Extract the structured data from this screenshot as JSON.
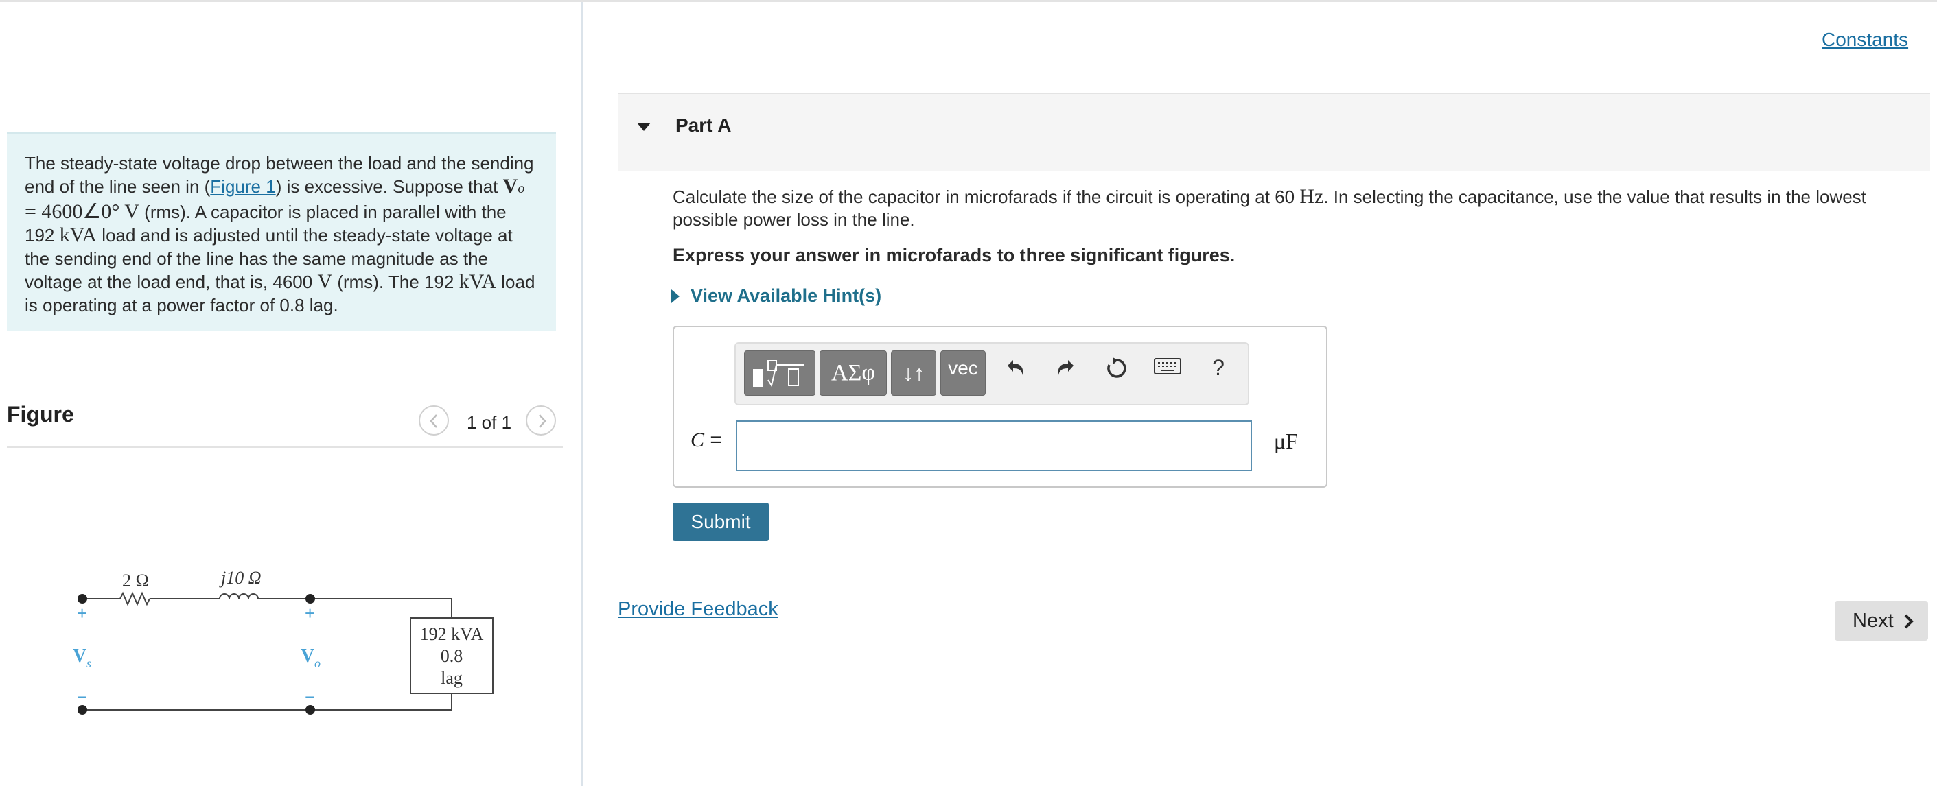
{
  "problem": {
    "seg1": "The steady-state voltage drop between the load and the sending end of the line seen in (",
    "figure_link": "Figure 1",
    "seg2": ") is excessive. Suppose that ",
    "vo_symbol": "V",
    "vo_sub": "o",
    "vo_value": " = 4600∠0° V",
    "seg3": " (rms). A capacitor is placed in parallel with the 192 ",
    "kva1": "kVA",
    "seg4": " load and is adjusted until the steady-state voltage at the sending end of the line has the same magnitude as the voltage at the load end, that is, 4600 ",
    "volt": "V",
    "seg5": " (rms). The 192 ",
    "kva2": "kVA",
    "seg6": " load is operating at a power factor of 0.8 lag."
  },
  "figure": {
    "title": "Figure",
    "counter": "1 of 1",
    "circuit": {
      "r_label": "2 Ω",
      "x_label": "j10 Ω",
      "vs_label": "V",
      "vs_sub": "s",
      "vo_label": "V",
      "vo_sub": "o",
      "plus": "+",
      "minus": "−",
      "load_line1": "192 kVA",
      "load_line2": "0.8",
      "load_line3": "lag"
    }
  },
  "constants_link": "Constants",
  "part": {
    "title": "Part A",
    "q1": "Calculate the size of the capacitor in microfarads if the circuit is operating at 60 ",
    "hz": "Hz",
    "q2": ". In selecting the capacitance, use the value that results in the lowest possible power loss in the line.",
    "instruction": "Express your answer in microfarads to three significant figures.",
    "hint_label": "View Available Hint(s)"
  },
  "answer": {
    "toolbar": {
      "greek": "ΑΣφ",
      "arrows": "↓↑",
      "vec": "vec",
      "help": "?"
    },
    "var_symbol": "C",
    "var_equals": " =",
    "input_value": "",
    "unit": "μF"
  },
  "submit_label": "Submit",
  "feedback_link": "Provide Feedback",
  "next_label": "Next",
  "colors": {
    "accent": "#2f7395",
    "link": "#1a6fa1",
    "hint": "#1f6f8b",
    "problem_bg": "#e6f4f6",
    "toolbar_btn": "#7d7d7d",
    "circuit_blue": "#4aa3d6"
  }
}
